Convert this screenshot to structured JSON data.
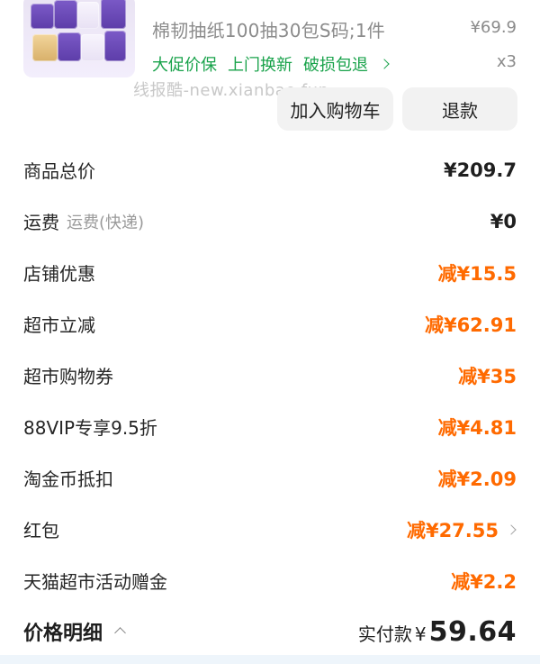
{
  "product": {
    "title": "棉韧抽纸100抽30包S码;1件",
    "price": "¥69.9",
    "quantity": "x3",
    "tags": [
      "大促价保",
      "上门换新",
      "破损包退"
    ],
    "watermark": "线报酷-new.xianbao.fun",
    "buttons": {
      "add_to_cart": "加入购物车",
      "refund": "退款"
    }
  },
  "summary": {
    "rows": [
      {
        "label": "商品总价",
        "sub": "",
        "value": "¥209.7",
        "tone": "black",
        "chevron": false
      },
      {
        "label": "运费",
        "sub": "运费(快递)",
        "value": "¥0",
        "tone": "black",
        "chevron": false
      },
      {
        "label": "店铺优惠",
        "sub": "",
        "value": "减¥15.5",
        "tone": "orange",
        "chevron": false
      },
      {
        "label": "超市立减",
        "sub": "",
        "value": "减¥62.91",
        "tone": "orange",
        "chevron": false
      },
      {
        "label": "超市购物券",
        "sub": "",
        "value": "减¥35",
        "tone": "orange",
        "chevron": false
      },
      {
        "label": "88VIP专享9.5折",
        "sub": "",
        "value": "减¥4.81",
        "tone": "orange",
        "chevron": false
      },
      {
        "label": "淘金币抵扣",
        "sub": "",
        "value": "减¥2.09",
        "tone": "orange",
        "chevron": false
      },
      {
        "label": "红包",
        "sub": "",
        "value": "减¥27.55",
        "tone": "orange",
        "chevron": true
      },
      {
        "label": "天猫超市活动赠金",
        "sub": "",
        "value": "减¥2.2",
        "tone": "orange",
        "chevron": false
      }
    ]
  },
  "footer": {
    "breakdown_label": "价格明细",
    "actual_label": "实付款",
    "currency": "¥",
    "amount": "59.64"
  },
  "colors": {
    "green": "#18a24a",
    "orange": "#ff6a00",
    "gray_text": "#8b8b8b",
    "button_bg": "#f2f2f2"
  },
  "icons": {
    "tag_chevron": "chevron-right-icon",
    "row_chevron": "chevron-right-icon",
    "breakdown_toggle": "chevron-up-icon"
  }
}
